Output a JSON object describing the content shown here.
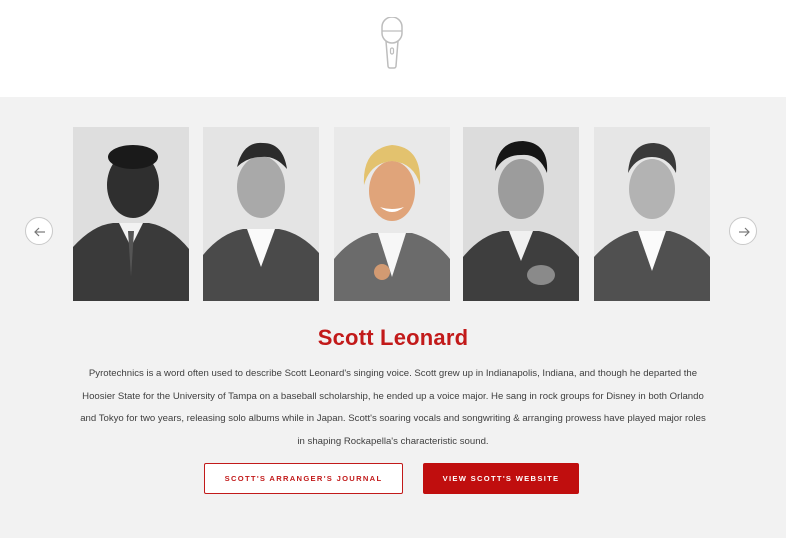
{
  "header": {
    "icon": "microphone-icon"
  },
  "carousel": {
    "prev_icon": "arrow-left-icon",
    "next_icon": "arrow-right-icon",
    "members": [
      {
        "description": "Member photo 1",
        "style": "grayscale"
      },
      {
        "description": "Member photo 2",
        "style": "grayscale"
      },
      {
        "description": "Member photo 3 (selected)",
        "style": "color"
      },
      {
        "description": "Member photo 4",
        "style": "grayscale"
      },
      {
        "description": "Member photo 5",
        "style": "grayscale"
      }
    ],
    "selected_index": 2
  },
  "profile": {
    "name": "Scott Leonard",
    "bio": "Pyrotechnics is a word often used to describe Scott Leonard's singing voice. Scott grew up in Indianapolis, Indiana, and though he departed the Hoosier State for the University of Tampa on a baseball scholarship, he ended up a voice major. He sang in rock groups for Disney in both Orlando and Tokyo for two years, releasing solo albums while in Japan. Scott's soaring vocals and songwriting & arranging prowess have played major roles in shaping Rockapella's characteristic sound."
  },
  "actions": {
    "journal_label": "Scott's Arranger's Journal",
    "website_label": "View Scott's Website"
  },
  "colors": {
    "accent": "#c21a1a",
    "band_bg": "#f2f2f2"
  }
}
